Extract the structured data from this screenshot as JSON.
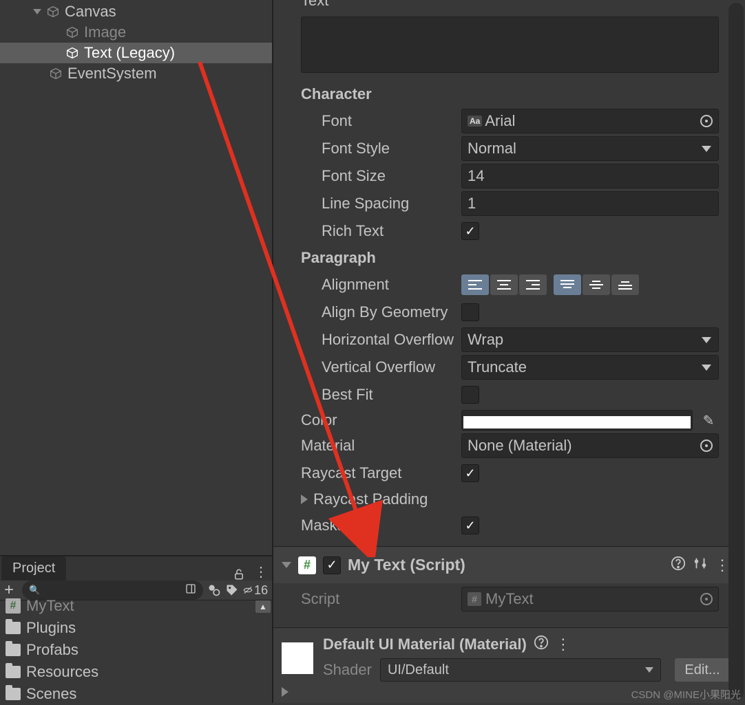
{
  "hierarchy": {
    "items": [
      {
        "name": "Canvas",
        "indent": 44,
        "foldout": true
      },
      {
        "name": "Image",
        "indent": 94,
        "dim": true
      },
      {
        "name": "Text (Legacy)",
        "indent": 94,
        "selected": true
      },
      {
        "name": "EventSystem",
        "indent": 70
      }
    ]
  },
  "project": {
    "tab_label": "Project",
    "search_placeholder": "",
    "hidden_count": "16",
    "items": [
      {
        "type": "script",
        "label": "MyText",
        "clipped": true
      },
      {
        "type": "folder",
        "label": "Plugins"
      },
      {
        "type": "folder",
        "label": "Profabs"
      },
      {
        "type": "folder",
        "label": "Resources"
      },
      {
        "type": "folder",
        "label": "Scenes",
        "clipped": true
      }
    ]
  },
  "inspector": {
    "text_section": {
      "label_text": "Text",
      "character_header": "Character",
      "font_label": "Font",
      "font_value": "Arial",
      "font_style_label": "Font Style",
      "font_style_value": "Normal",
      "font_size_label": "Font Size",
      "font_size_value": "14",
      "line_spacing_label": "Line Spacing",
      "line_spacing_value": "1",
      "rich_text_label": "Rich Text",
      "rich_text": true,
      "paragraph_header": "Paragraph",
      "alignment_label": "Alignment",
      "align_by_geometry_label": "Align By Geometry",
      "align_by_geometry": false,
      "h_overflow_label": "Horizontal Overflow",
      "h_overflow_value": "Wrap",
      "v_overflow_label": "Vertical Overflow",
      "v_overflow_value": "Truncate",
      "best_fit_label": "Best Fit",
      "best_fit": false,
      "color_label": "Color",
      "color_value": "#ffffff",
      "material_label": "Material",
      "material_value": "None (Material)",
      "raycast_target_label": "Raycast Target",
      "raycast_target": true,
      "raycast_padding_label": "Raycast Padding",
      "maskable_label": "Maskable",
      "maskable": true
    },
    "script_component": {
      "title": "My Text (Script)",
      "enabled": true,
      "script_label": "Script",
      "script_value": "MyText"
    },
    "material_block": {
      "title": "Default UI Material (Material)",
      "shader_label": "Shader",
      "shader_value": "UI/Default",
      "edit_label": "Edit..."
    }
  },
  "watermark": "CSDN @MINE小果阳光"
}
